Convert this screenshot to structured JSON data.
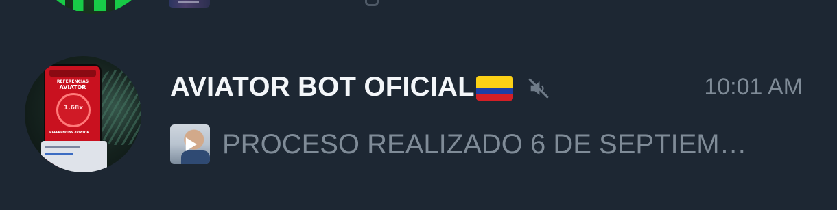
{
  "chat": {
    "title": "AVIATOR BOT OFICIAL",
    "flag": "colombia-flag",
    "muted_icon": "muted-speaker-icon",
    "time": "10:01 AM",
    "preview": {
      "thumbnail": "video-thumbnail",
      "play_icon": "play-icon",
      "text": "PROCESO REALIZADO 6 DE SEPTIEM…"
    },
    "avatar": {
      "line1": "REFERENCIAS",
      "line2": "AVIATOR",
      "multiplier": "1.68x",
      "caption": "REFERENCIAS AVIATOR"
    }
  },
  "colors": {
    "background": "#1d2733",
    "title": "#f3f6f9",
    "secondary_text": "#7f8b97"
  }
}
